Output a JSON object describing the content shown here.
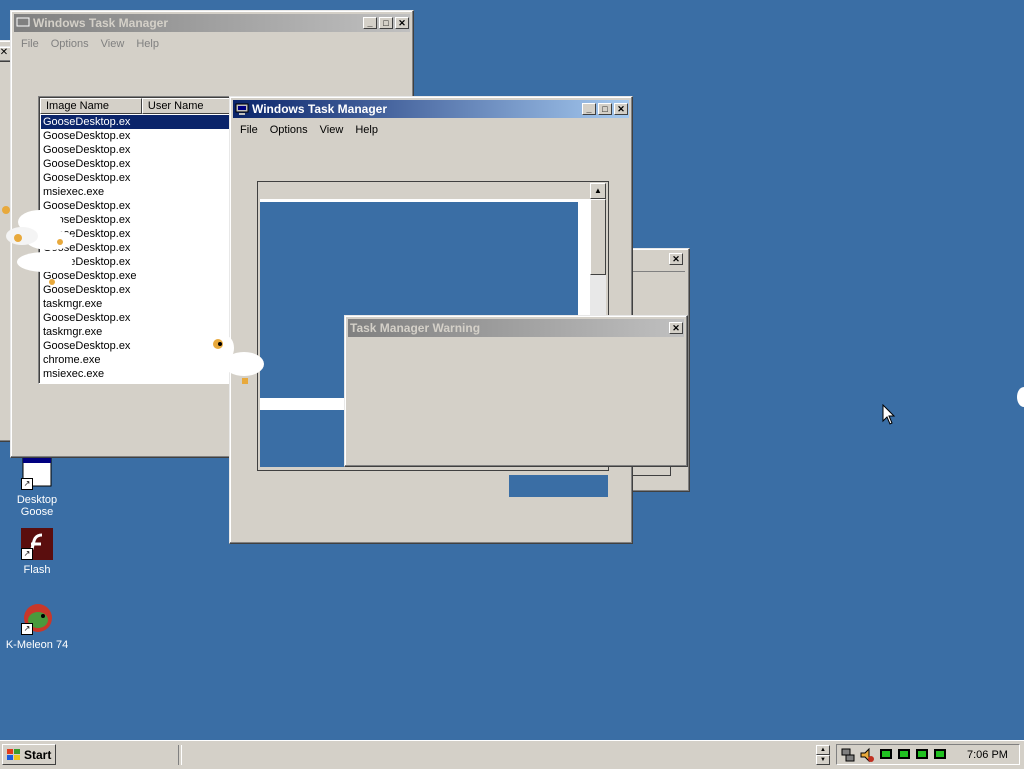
{
  "background_window": {
    "title": "Windows Task Manager",
    "menu": [
      "File",
      "Options",
      "View",
      "Help"
    ],
    "columns": [
      "Image Name",
      "User Name"
    ],
    "processes": [
      "GooseDesktop.ex",
      "GooseDesktop.ex",
      "GooseDesktop.ex",
      "GooseDesktop.ex",
      "GooseDesktop.ex",
      "msiexec.exe",
      "GooseDesktop.ex",
      "GooseDesktop.ex",
      "GooseDesktop.ex",
      "GooseDesktop.ex",
      "GooseDesktop.ex",
      "GooseDesktop.exe",
      "GooseDesktop.ex",
      "taskmgr.exe",
      "GooseDesktop.ex",
      "taskmgr.exe",
      "GooseDesktop.ex",
      "chrome.exe",
      "msiexec.exe"
    ],
    "selected_index": 0
  },
  "front_window": {
    "title": "Windows Task Manager",
    "menu": [
      "File",
      "Options",
      "View",
      "Help"
    ]
  },
  "warning_dialog": {
    "title": "Task Manager Warning"
  },
  "desktop_icons": [
    {
      "label_line1": "Desktop",
      "label_line2": "Goose",
      "icon": "goose-app-icon"
    },
    {
      "label_line1": "Flash",
      "label_line2": "",
      "icon": "flash-icon"
    },
    {
      "label_line1": "K-Meleon 74",
      "label_line2": "",
      "icon": "k-meleon-icon"
    }
  ],
  "taskbar": {
    "start_label": "Start",
    "clock": "7:06 PM"
  },
  "colors": {
    "desktop": "#3a6ea5",
    "window_face": "#d4d0c8",
    "active_title": "#0a246a",
    "selection": "#0a246a"
  }
}
